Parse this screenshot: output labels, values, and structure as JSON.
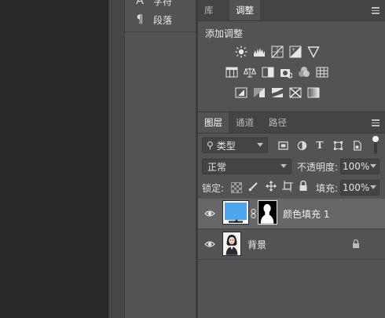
{
  "left_panel": {
    "items": [
      {
        "label": "字符",
        "icon": "character-icon"
      },
      {
        "label": "段落",
        "icon": "paragraph-icon"
      }
    ]
  },
  "top_tabs": {
    "tabs": [
      {
        "label": "库",
        "active": false
      },
      {
        "label": "调整",
        "active": true
      }
    ]
  },
  "adjustments": {
    "title": "添加调整",
    "row1": [
      "brightness-contrast-icon",
      "levels-icon",
      "curves-icon",
      "exposure-icon",
      "vibrance-icon"
    ],
    "row2": [
      "hue-saturation-icon",
      "color-balance-icon",
      "black-white-icon",
      "photo-filter-icon",
      "channel-mixer-icon",
      "color-lookup-icon"
    ],
    "row3": [
      "invert-icon",
      "posterize-icon",
      "threshold-icon",
      "selective-color-icon",
      "gradient-map-icon"
    ]
  },
  "layers_tabs": {
    "tabs": [
      {
        "label": "图层",
        "active": true
      },
      {
        "label": "通道",
        "active": false
      },
      {
        "label": "路径",
        "active": false
      }
    ]
  },
  "filter": {
    "kind_label": "类型",
    "icons": [
      "pixel-filter-icon",
      "adjustment-filter-icon",
      "type-filter-icon",
      "shape-filter-icon",
      "smart-object-filter-icon"
    ]
  },
  "blend": {
    "mode": "正常",
    "opacity_label": "不透明度:",
    "opacity_value": "100%"
  },
  "lock": {
    "label": "锁定:",
    "fill_label": "填充:",
    "fill_value": "100%"
  },
  "layers": [
    {
      "name": "颜色填充 1",
      "selected": true,
      "fill_color": "#4da6ee"
    },
    {
      "name": "背景",
      "selected": false,
      "locked": true
    }
  ]
}
